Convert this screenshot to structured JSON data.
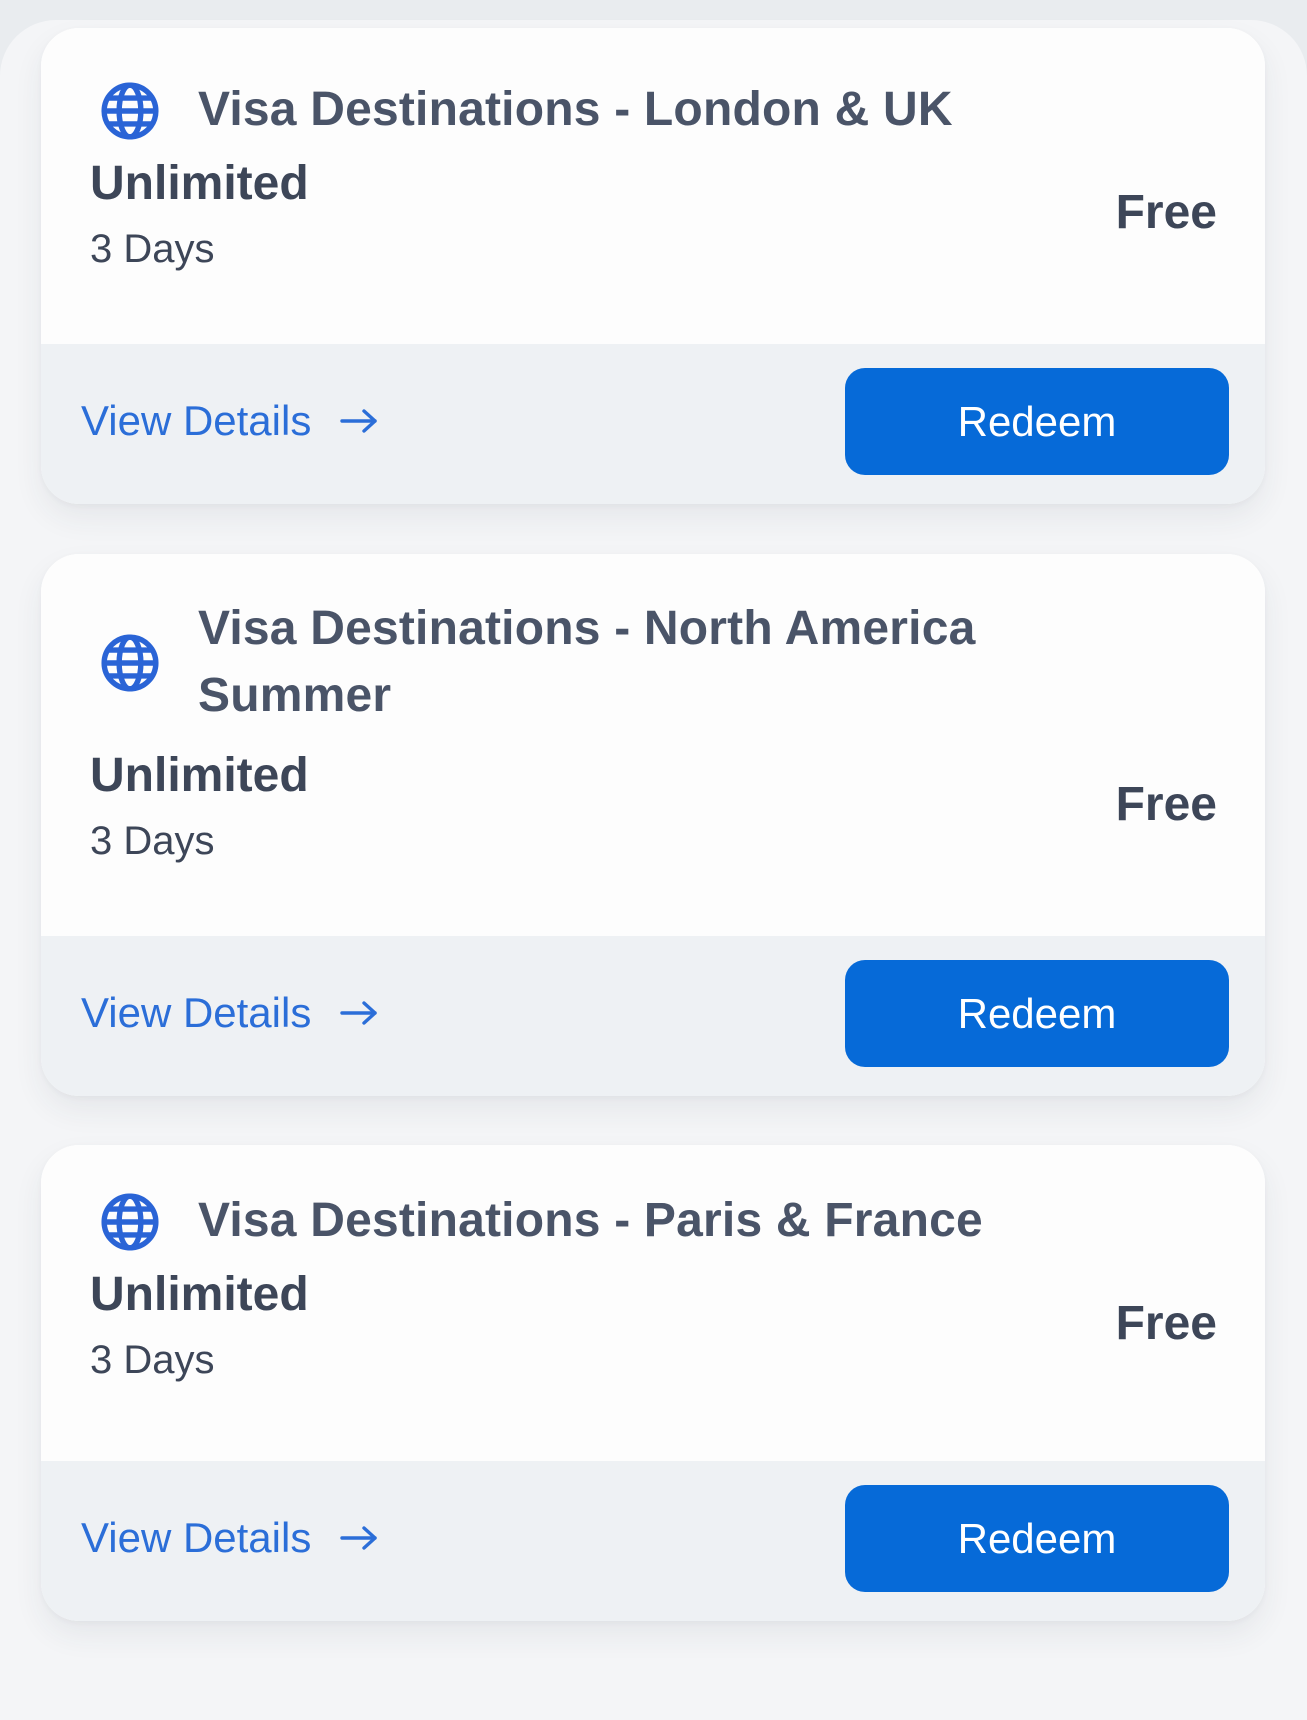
{
  "colors": {
    "accent": "#066ad8",
    "link": "#2b6ed8",
    "text": "#3d4658",
    "title": "#4a5468",
    "footer_bg": "#eef1f4"
  },
  "offers": [
    {
      "icon": "globe-icon",
      "title": "Visa Destinations - London & UK",
      "plan": "Unlimited",
      "duration": "3 Days",
      "price": "Free",
      "details_label": "View Details",
      "details_icon": "arrow-right-icon",
      "redeem_label": "Redeem"
    },
    {
      "icon": "globe-icon",
      "title": "Visa Destinations - North America Summer",
      "plan": "Unlimited",
      "duration": "3 Days",
      "price": "Free",
      "details_label": "View Details",
      "details_icon": "arrow-right-icon",
      "redeem_label": "Redeem"
    },
    {
      "icon": "globe-icon",
      "title": "Visa Destinations - Paris & France",
      "plan": "Unlimited",
      "duration": "3 Days",
      "price": "Free",
      "details_label": "View Details",
      "details_icon": "arrow-right-icon",
      "redeem_label": "Redeem"
    }
  ]
}
